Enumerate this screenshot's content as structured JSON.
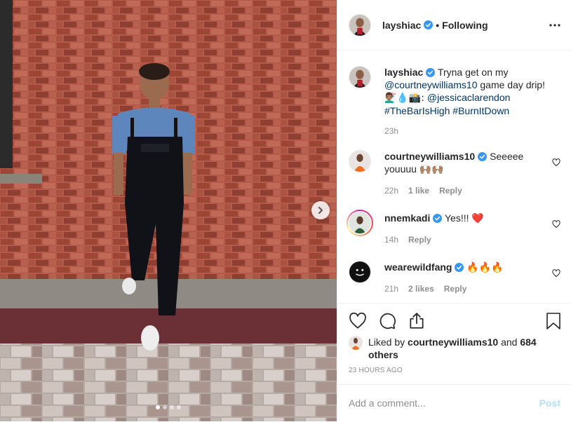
{
  "post": {
    "author": "layshiac",
    "follow_state": "Following",
    "separator": "•",
    "caption": {
      "text_before": "Tryna get on my",
      "mention_1": "@courtneywilliams10",
      "text_after_mention": "game day drip!",
      "emoji_credit": "💇🏽‍♂️💧📸:",
      "mention_2": "@jessicaclarendon",
      "hashtag_1": "#TheBarIsHigh",
      "hashtag_2": "#BurnItDown",
      "time": "23h"
    },
    "comments": [
      {
        "user": "courtneywilliams10",
        "text": "Seeeee youuuu 🙌🏽🙌🏽",
        "time": "22h",
        "likes": "1 like",
        "reply": "Reply"
      },
      {
        "user": "nnemkadi",
        "text": "Yes!!! ❤️",
        "time": "14h",
        "likes": "",
        "reply": "Reply"
      },
      {
        "user": "wearewildfang",
        "text": "🔥🔥🔥",
        "time": "21h",
        "likes": "2 likes",
        "reply": "Reply"
      }
    ],
    "liked_by": {
      "prefix": "Liked by",
      "user": "courtneywilliams10",
      "joiner": "and",
      "others": "684 others"
    },
    "posted_ago": "23 HOURS AGO",
    "add_comment": {
      "placeholder": "Add a comment...",
      "post_label": "Post"
    },
    "carousel": {
      "count": 4,
      "active": 0
    }
  },
  "icons": {
    "verified": "verified-badge-icon",
    "more": "more-options-icon",
    "like": "heart-icon",
    "comment": "comment-icon",
    "share": "share-icon",
    "save": "bookmark-icon",
    "next": "chevron-right-icon"
  },
  "colors": {
    "verified_blue": "#3897f0",
    "link_blue": "#003569",
    "muted": "#8e8e8e",
    "post_disabled": "#b2dffc",
    "heart_red": "#ed4956"
  }
}
